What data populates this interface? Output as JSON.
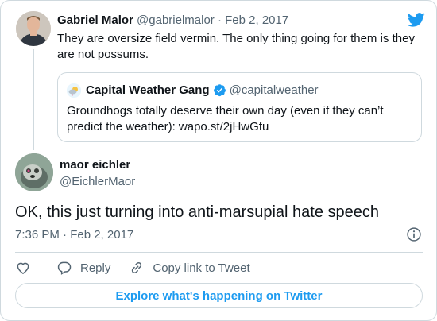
{
  "parent_tweet": {
    "author_name": "Gabriel Malor",
    "meta": "@gabrielmalor · Feb 2, 2017",
    "text": "They are oversize field vermin. The only thing going for them is they are not possums."
  },
  "quoted_tweet": {
    "author_name": "Capital Weather Gang",
    "handle": "@capitalweather",
    "text": "Groundhogs totally deserve their own day (even if they can’t predict the weather): wapo.st/2jHwGfu"
  },
  "main_tweet": {
    "author_name": "maor eichler",
    "handle": "@EichlerMaor",
    "text": "OK, this just turning into anti-marsupial hate speech",
    "timestamp": "7:36 PM · Feb 2, 2017"
  },
  "actions": {
    "reply_label": "Reply",
    "copy_link_label": "Copy link to Tweet"
  },
  "explore_label": "Explore what's happening on Twitter",
  "colors": {
    "accent": "#1d9bf0",
    "text": "#0f1419",
    "secondary": "#536471",
    "border": "#cfd9de"
  }
}
